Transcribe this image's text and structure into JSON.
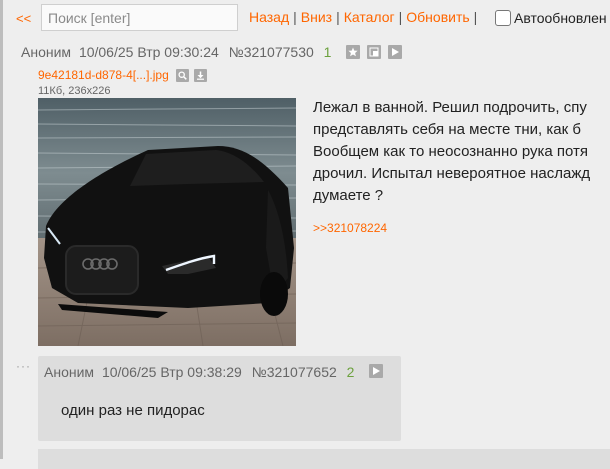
{
  "nav": {
    "back": "<<",
    "search_placeholder": "Поиск [enter]",
    "links": [
      "Назад",
      "Вниз",
      "Каталог",
      "Обновить"
    ],
    "autoupdate_label": "Автообновлен"
  },
  "op": {
    "author": "Аноним",
    "date": "10/06/25 Втр 09:30:24",
    "post_number": "№321077530",
    "reply_count": "1",
    "file_name": "9e42181d-d878-4[...].jpg",
    "file_meta": "11Кб, 236x226",
    "text_lines": [
      "Лежал в ванной. Решил подрочить, спу",
      "представлять себя на месте тни, как б",
      "Вообщем как то неосознанно рука потя",
      "дрочил. Испытал невероятное наслажд",
      "думаете ?"
    ],
    "reply_link": ">>321078224"
  },
  "reply": {
    "author": "Аноним",
    "date": "10/06/25 Втр 09:38:29",
    "post_number": "№321077652",
    "reply_count": "2",
    "text": "один раз не пидорас"
  },
  "colors": {
    "accent": "#ff6600",
    "reply_count": "#6ca13e",
    "background": "#eeeeee",
    "post_background": "#dddddd"
  }
}
